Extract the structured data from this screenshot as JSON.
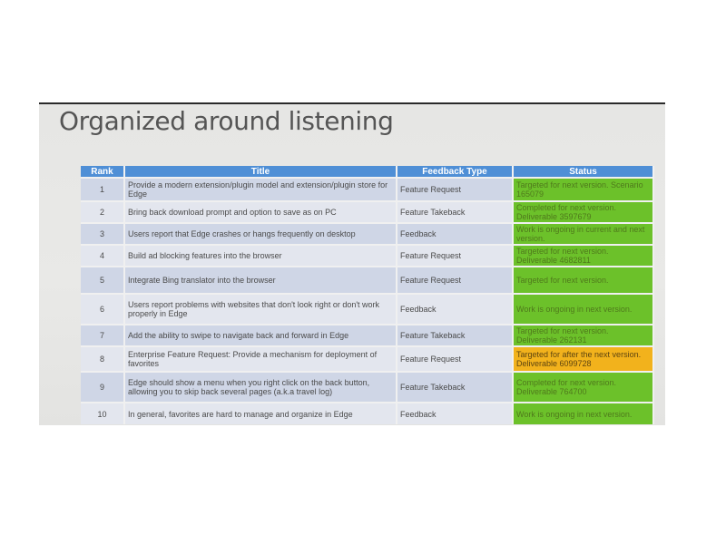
{
  "slide": {
    "title": "Organized around listening"
  },
  "table": {
    "headers": {
      "rank": "Rank",
      "title": "Title",
      "type": "Feedback Type",
      "status": "Status"
    },
    "rows": [
      {
        "rank": "1",
        "title": "Provide a modern extension/plugin model and extension/plugin store for Edge",
        "type": "Feature Request",
        "status": "Targeted for next version. Scenario 165079",
        "status_color": "#6cc12a"
      },
      {
        "rank": "2",
        "title": "Bring back download prompt and option to save as on PC",
        "type": "Feature Takeback",
        "status": "Completed for next version. Deliverable 3597679",
        "status_color": "#6cc12a"
      },
      {
        "rank": "3",
        "title": "Users report that Edge crashes or hangs frequently on desktop",
        "type": "Feedback",
        "status": "Work is ongoing in current and next version.",
        "status_color": "#6cc12a"
      },
      {
        "rank": "4",
        "title": "Build ad blocking features into the browser",
        "type": "Feature Request",
        "status": "Targeted for next version. Deliverable 4682811",
        "status_color": "#6cc12a"
      },
      {
        "rank": "5",
        "title": "Integrate Bing translator into the browser",
        "type": "Feature Request",
        "status": "Targeted for next version.",
        "status_color": "#6cc12a"
      },
      {
        "rank": "6",
        "title": "Users report problems with websites that don't look right or don't work properly in Edge",
        "type": "Feedback",
        "status": "Work is ongoing in next version.",
        "status_color": "#6cc12a"
      },
      {
        "rank": "7",
        "title": "Add the ability to swipe to navigate back and forward in Edge",
        "type": "Feature Takeback",
        "status": "Targeted for next version. Deliverable 262131",
        "status_color": "#6cc12a"
      },
      {
        "rank": "8",
        "title": "Enterprise Feature Request: Provide a mechanism for deployment of favorites",
        "type": "Feature Request",
        "status": "Targeted for after the next version. Deliverable 6099728",
        "status_color": "#f2b21c"
      },
      {
        "rank": "9",
        "title": "Edge should show a menu when you right click on the back button, allowing you to skip back several pages (a.k.a travel log)",
        "type": "Feature Takeback",
        "status": "Completed for next version. Deliverable 764700",
        "status_color": "#6cc12a"
      },
      {
        "rank": "10",
        "title": "In general, favorites are hard to manage and organize in Edge",
        "type": "Feedback",
        "status": "Work is ongoing in next version.",
        "status_color": "#6cc12a"
      }
    ]
  }
}
